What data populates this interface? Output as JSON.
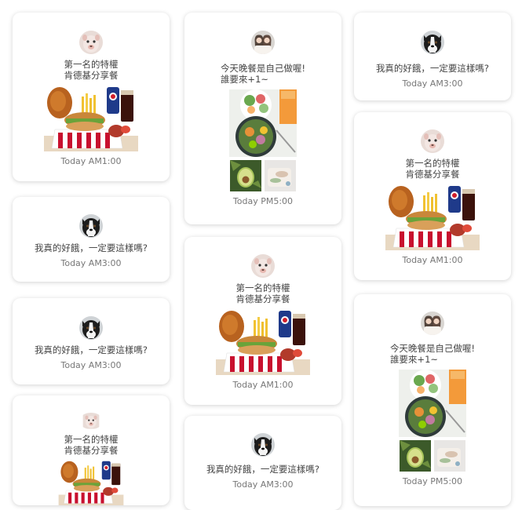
{
  "messages": {
    "kfc_text": "第一名的特權\n肯德基分享餐",
    "hungry_text": "我真的好餓，一定要這樣嗎?",
    "dinner_text": "今天晚餐是自己做喔!\n誰要來+1~"
  },
  "times": {
    "am1": "Today AM1:00",
    "am3": "Today AM3:00",
    "pm5": "Today PM5:00"
  },
  "avatars": {
    "alpaca": "alpaca-avatar",
    "dog": "border-collie-avatar",
    "girls": "two-girls-avatar"
  },
  "images": {
    "kfc": "kfc-meal-photo",
    "salad": "salad-bowl-photo",
    "avocado": "avocado-photo",
    "cutting": "cutting-board-photo"
  },
  "colors": {
    "card_bg": "#ffffff",
    "text": "#444444",
    "time": "#777777"
  }
}
